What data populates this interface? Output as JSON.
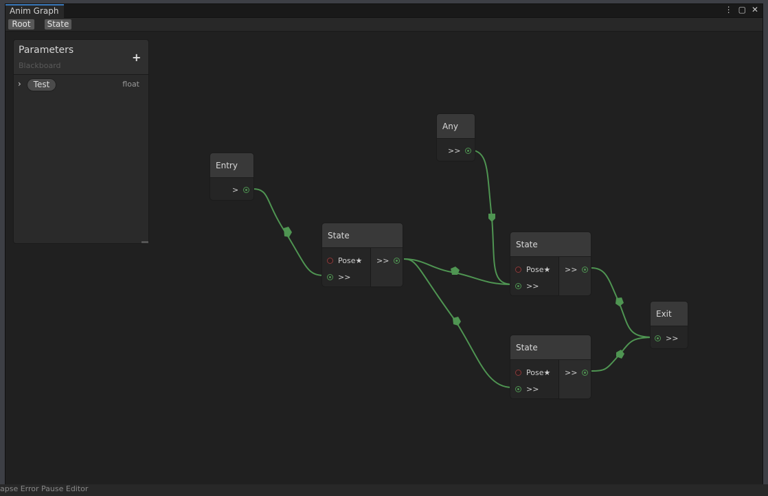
{
  "window": {
    "tab_title": "Anim Graph",
    "menu_icon": "kebab-menu-icon",
    "maximize_icon": "maximize-icon",
    "close_icon": "close-icon"
  },
  "toolbar": {
    "breadcrumbs": [
      "Root",
      "State"
    ]
  },
  "blackboard": {
    "title": "Parameters",
    "subtitle": "Blackboard",
    "add_label": "+",
    "parameters": [
      {
        "name": "Test",
        "type": "float"
      }
    ]
  },
  "nodes": {
    "entry": {
      "title": "Entry",
      "out_label": ">"
    },
    "any": {
      "title": "Any",
      "out_label": ">>"
    },
    "state1": {
      "title": "State",
      "pose_label": "Pose★",
      "in_label": ">>",
      "out_label": ">>"
    },
    "state2": {
      "title": "State",
      "pose_label": "Pose★",
      "in_label": ">>",
      "out_label": ">>"
    },
    "state3": {
      "title": "State",
      "pose_label": "Pose★",
      "in_label": ">>",
      "out_label": ">>"
    },
    "exit": {
      "title": "Exit",
      "in_label": ">>"
    }
  },
  "colors": {
    "edge": "#4f9552",
    "accent_tab": "#3a79bb",
    "graph_bg": "#202020"
  },
  "under_text": "apse  Error Pause  Editor"
}
